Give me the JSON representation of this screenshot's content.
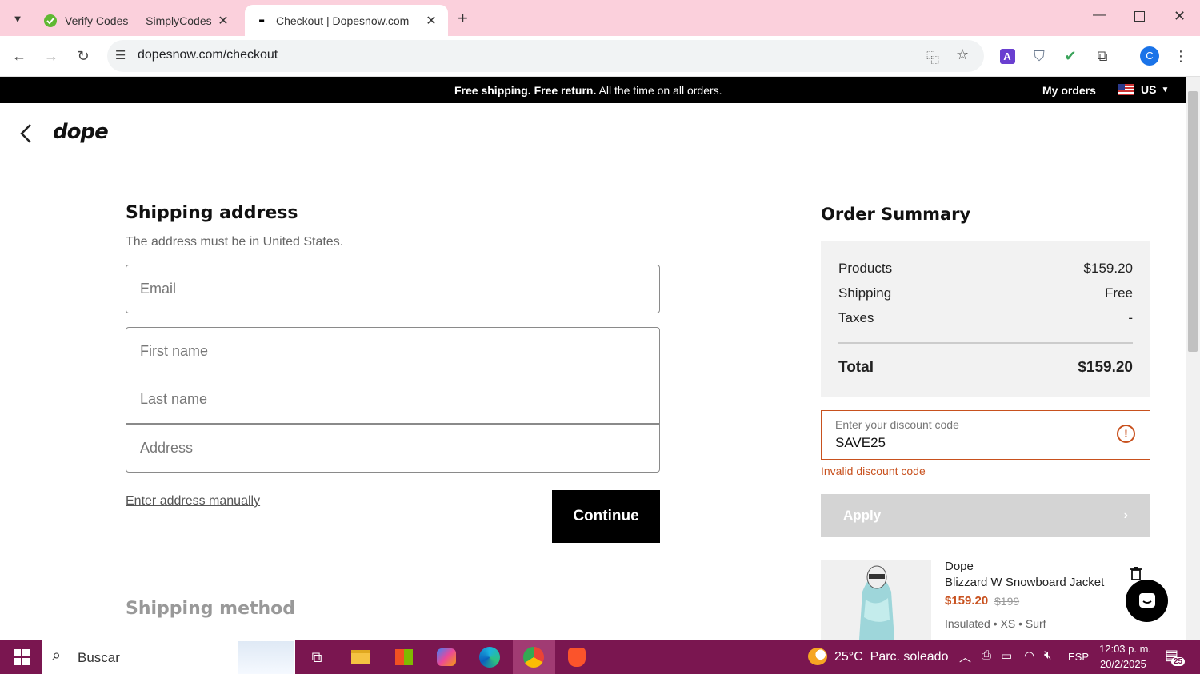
{
  "browser": {
    "tabs": [
      {
        "title": "Verify Codes — SimplyCodes",
        "active": false
      },
      {
        "title": "Checkout | Dopesnow.com",
        "active": true
      }
    ],
    "url": "dopesnow.com/checkout",
    "profile_initial": "C"
  },
  "promo_bar": {
    "message_bold": "Free shipping. Free return.",
    "message_rest": " All the time on all orders.",
    "my_orders": "My orders",
    "country": "US"
  },
  "header": {
    "logo": "dope"
  },
  "shipping": {
    "title": "Shipping address",
    "subtitle": "The address must be in United States.",
    "email_placeholder": "Email",
    "first_name_placeholder": "First name",
    "last_name_placeholder": "Last name",
    "address_placeholder": "Address",
    "manual_link": "Enter address manually",
    "continue_label": "Continue",
    "method_title": "Shipping method"
  },
  "summary": {
    "title": "Order Summary",
    "rows": [
      {
        "label": "Products",
        "value": "$159.20"
      },
      {
        "label": "Shipping",
        "value": "Free"
      },
      {
        "label": "Taxes",
        "value": "-"
      }
    ],
    "total_label": "Total",
    "total_value": "$159.20",
    "discount_label": "Enter your discount code",
    "discount_value": "SAVE25",
    "discount_error": "Invalid discount code",
    "apply_label": "Apply",
    "product": {
      "brand": "Dope",
      "name": "Blizzard W Snowboard Jacket",
      "price": "$159.20",
      "original_price": "$199",
      "details": "Insulated • XS • Surf"
    }
  },
  "taskbar": {
    "search_placeholder": "Buscar",
    "weather": "25°C  Parc. soleado",
    "lang": "ESP",
    "time": "12:03 p. m.",
    "date": "20/2/2025",
    "notif_count": "25"
  },
  "colors": {
    "accent_error": "#c8511e",
    "pink_chrome": "#fbd0dc",
    "taskbar": "#7a1650"
  }
}
